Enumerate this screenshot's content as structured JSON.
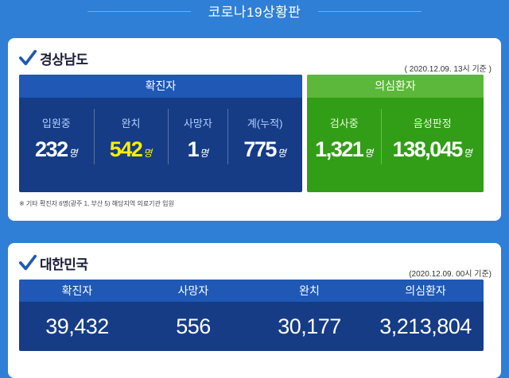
{
  "header": {
    "title": "코로나19상황판"
  },
  "gyeongnam": {
    "region": "경상남도",
    "timestamp": "( 2020.12.09. 13시 기준 )",
    "confirmed": {
      "title": "확진자",
      "items": [
        {
          "label": "입원중",
          "value": "232",
          "unit": "명"
        },
        {
          "label": "완치",
          "value": "542",
          "unit": "명"
        },
        {
          "label": "사망자",
          "value": "1",
          "unit": "명"
        },
        {
          "label": "계(누적)",
          "value": "775",
          "unit": "명"
        }
      ]
    },
    "suspected": {
      "title": "의심환자",
      "items": [
        {
          "label": "검사중",
          "value": "1,321",
          "unit": "명"
        },
        {
          "label": "음성판정",
          "value": "138,045",
          "unit": "명"
        }
      ]
    },
    "note": "※ 기타 확진자 6명(광주 1, 부산 5) 해당지역 의료기관 입원"
  },
  "korea": {
    "region": "대한민국",
    "timestamp": "(2020.12.09. 00시 기준)",
    "headers": [
      "확진자",
      "사망자",
      "완치",
      "의심환자"
    ],
    "values": [
      "39,432",
      "556",
      "30,177",
      "3,213,804"
    ]
  },
  "colors": {
    "background": "#2f7fd6",
    "panel_blue": "#163c86",
    "panel_blue_header": "#1f58b5",
    "panel_green": "#329d17",
    "panel_green_header": "#5cb83a",
    "highlight_yellow": "#ffee00"
  },
  "icons": {
    "section_marker": "checkmark-icon"
  }
}
